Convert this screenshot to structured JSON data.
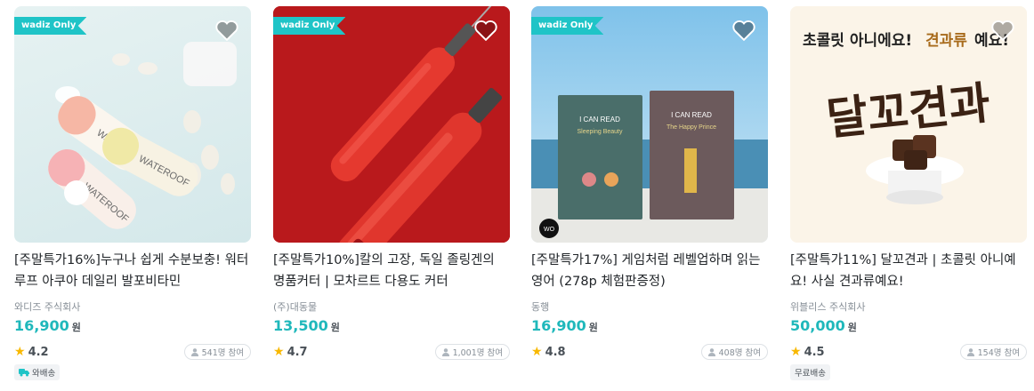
{
  "products": [
    {
      "badge": "wadiz Only",
      "title": "[주말특가16%]누구나 쉽게 수분보충! 워터루프 아쿠아 데일리 발포비타민",
      "maker": "와디즈 주식회사",
      "price": "16,900",
      "currency": "원",
      "rating": "4.2",
      "participants": "541명 참여",
      "shipping": "와배송",
      "image_label": "WATEROOF"
    },
    {
      "badge": "wadiz Only",
      "title": "[주말특가10%]칼의 고장, 독일 졸링겐의 명품커터 | 모차르트 다용도 커터",
      "maker": "(주)대동물",
      "price": "13,500",
      "currency": "원",
      "rating": "4.7",
      "participants": "1,001명 참여",
      "shipping": ""
    },
    {
      "badge": "wadiz Only",
      "title": "[주말특가17%] 게임처럼 레벨업하며 읽는 영어 (278p 체험판증정)",
      "maker": "동행",
      "price": "16,900",
      "currency": "원",
      "rating": "4.8",
      "participants": "408명 참여",
      "shipping": "",
      "book1_title": "I CAN READ",
      "book1_sub": "Sleeping Beauty",
      "book2_title": "I CAN READ",
      "book2_sub": "The Happy Prince"
    },
    {
      "badge": "",
      "title": "[주말특가11%] 달꼬견과 | 초콜릿 아니예요! 사실 견과류예요!",
      "maker": "위블리스 주식회사",
      "price": "50,000",
      "currency": "원",
      "rating": "4.5",
      "participants": "154명 참여",
      "shipping": "무료배송",
      "banner_text_a": "초콜릿 아니에요!",
      "banner_text_b": "견과류",
      "banner_text_c": "예요!",
      "big_text": "달꼬견과"
    }
  ],
  "colors": {
    "accent": "#1fc4c7",
    "price": "#1fb8bb",
    "star": "#f8b800"
  }
}
